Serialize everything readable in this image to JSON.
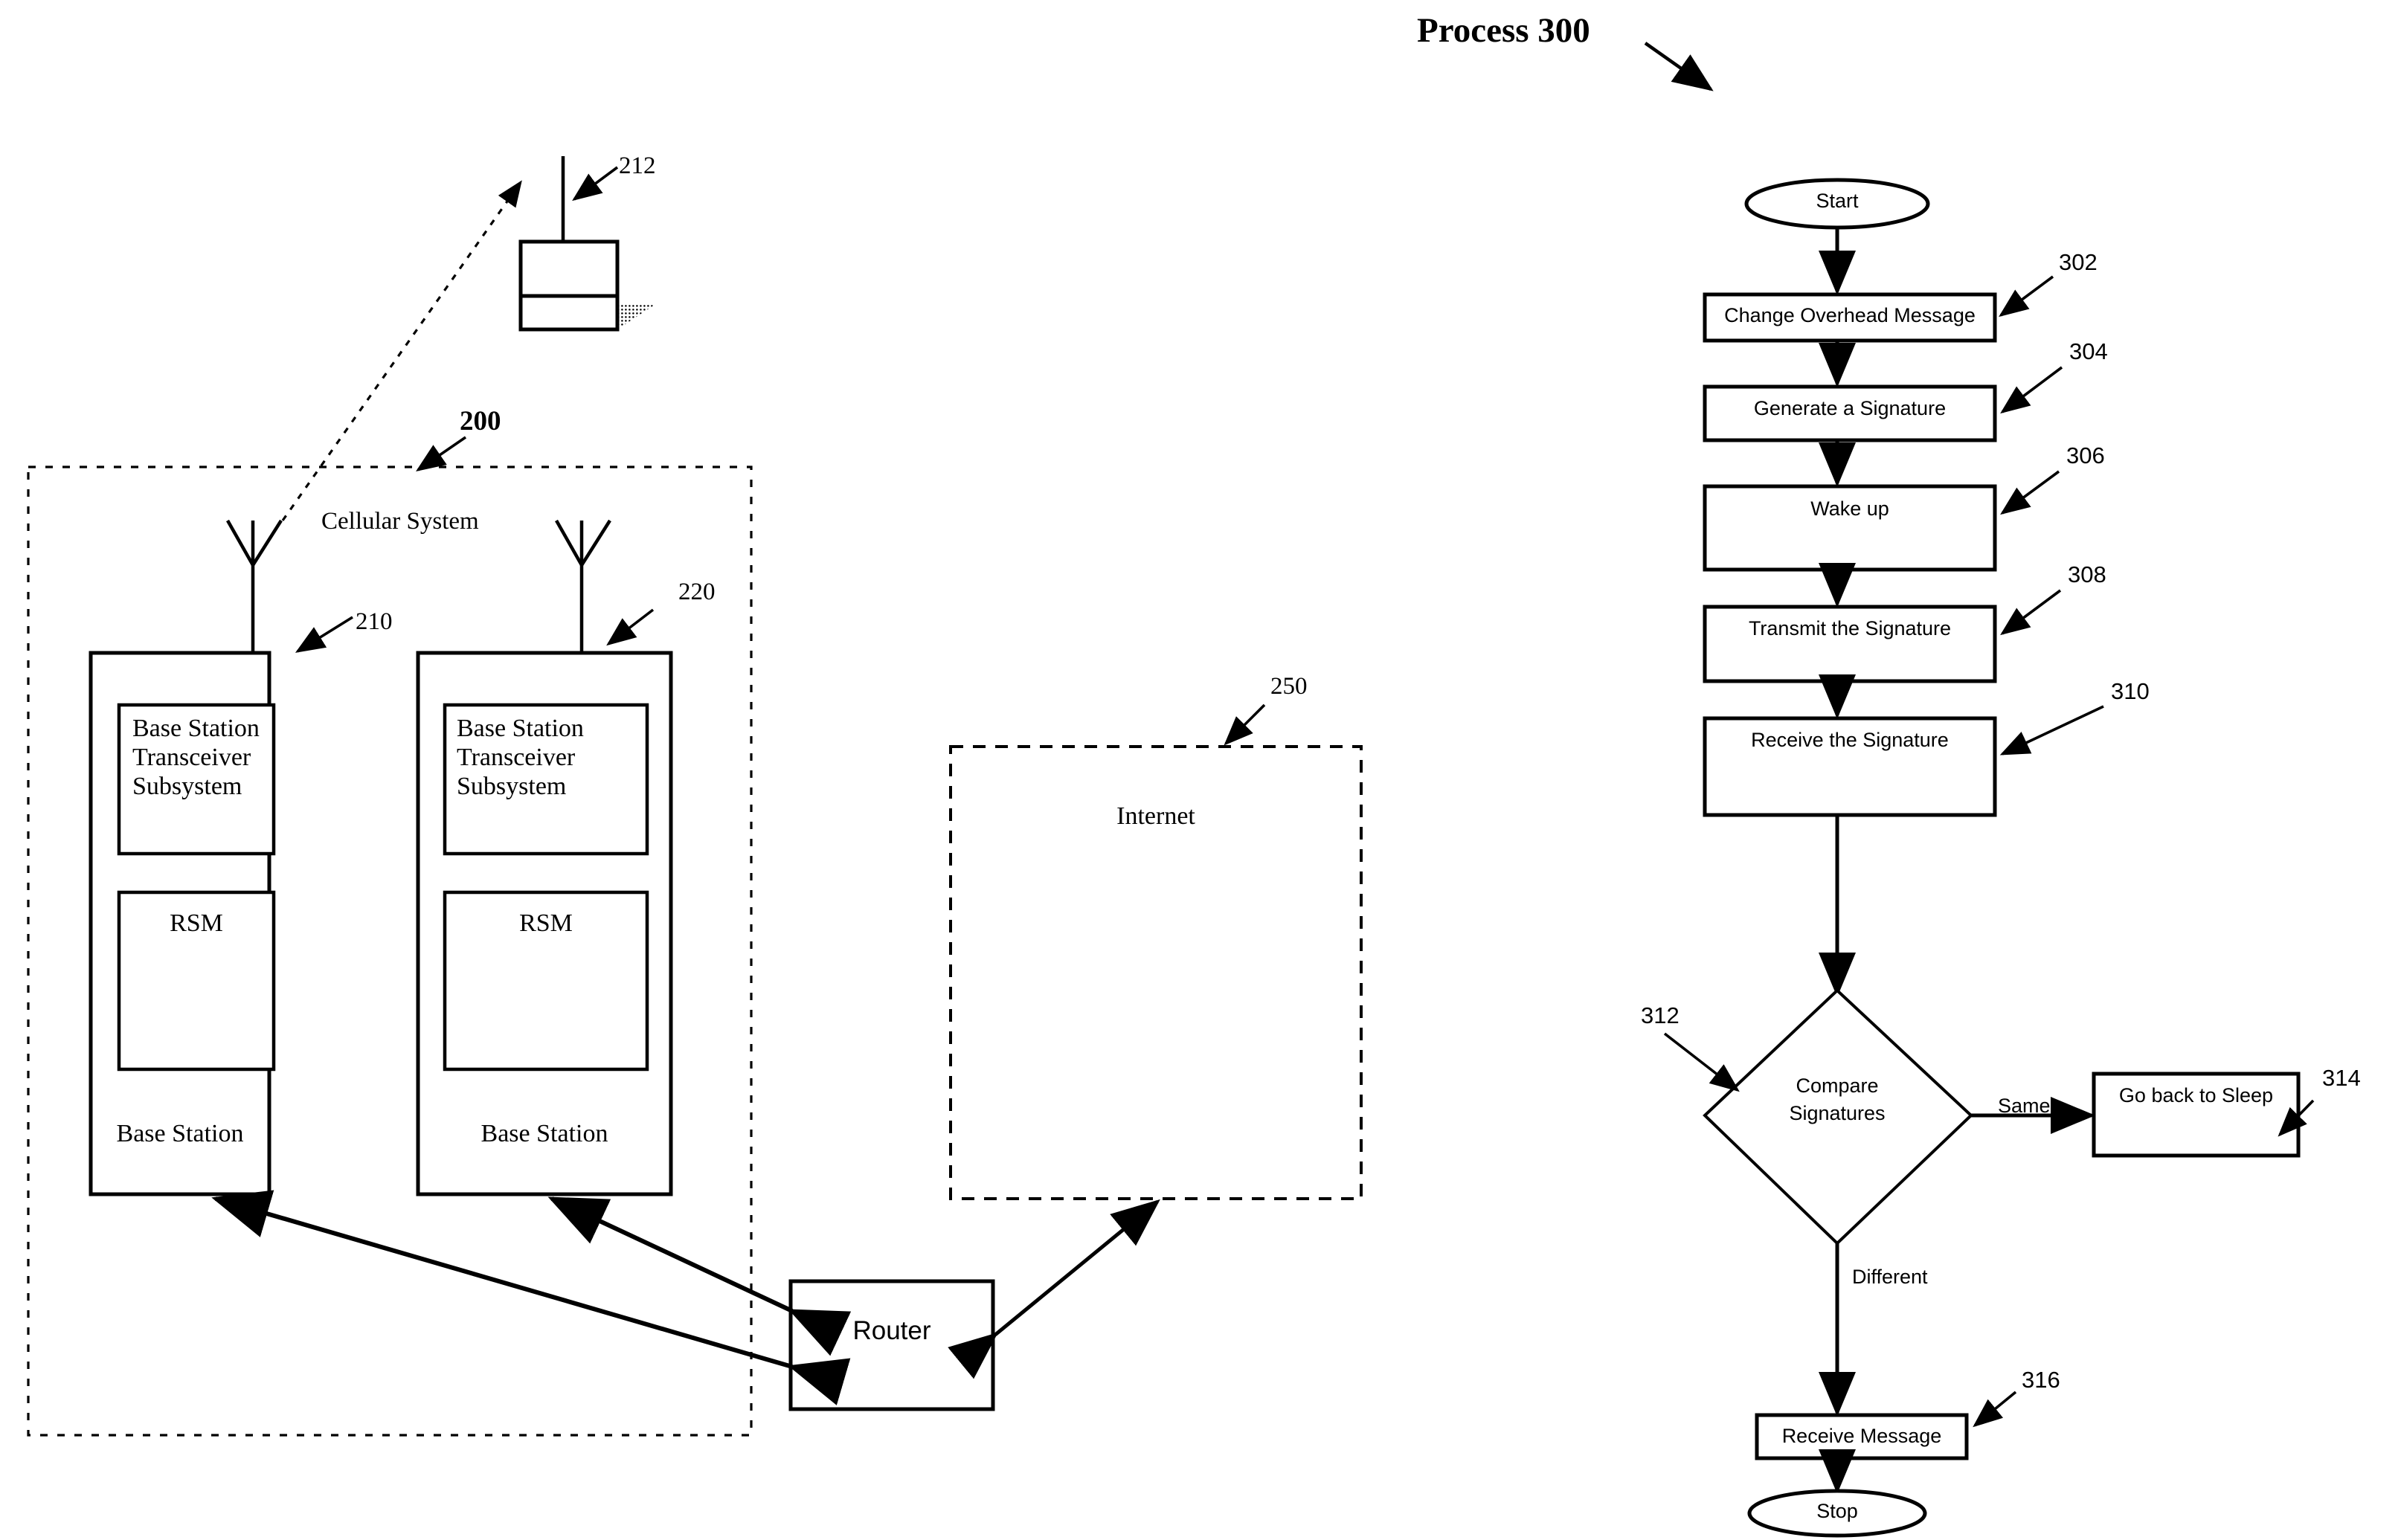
{
  "figure": {
    "title": "Process 300",
    "system_label": "200",
    "system_name": "Cellular System",
    "mobile_station_ref": "212",
    "internet_ref": "250",
    "internet_label": "Internet",
    "router_label": "Router"
  },
  "base_stations": [
    {
      "ref": "210",
      "transceiver_label": "Base Station\nTransceiver\nSubsystem",
      "rsm_label": "RSM",
      "name_label": "Base Station"
    },
    {
      "ref": "220",
      "transceiver_label": "Base Station\nTransceiver\nSubsystem",
      "rsm_label": "RSM",
      "name_label": "Base Station"
    }
  ],
  "flowchart": {
    "start_label": "Start",
    "stop_label": "Stop",
    "steps": [
      {
        "ref": "302",
        "label": "Change Overhead Message"
      },
      {
        "ref": "304",
        "label": "Generate a Signature"
      },
      {
        "ref": "306",
        "label": "Wake up"
      },
      {
        "ref": "308",
        "label": "Transmit the Signature"
      },
      {
        "ref": "310",
        "label": "Receive the Signature"
      }
    ],
    "decision": {
      "ref": "312",
      "line1": "Compare",
      "line2": "Signatures",
      "branch_same": "Same",
      "branch_different": "Different"
    },
    "sleep_step": {
      "ref": "314",
      "label": "Go back to Sleep"
    },
    "receive_step": {
      "ref": "316",
      "label": "Receive Message"
    }
  },
  "colors": {
    "ink": "#000000",
    "paper": "#ffffff"
  }
}
